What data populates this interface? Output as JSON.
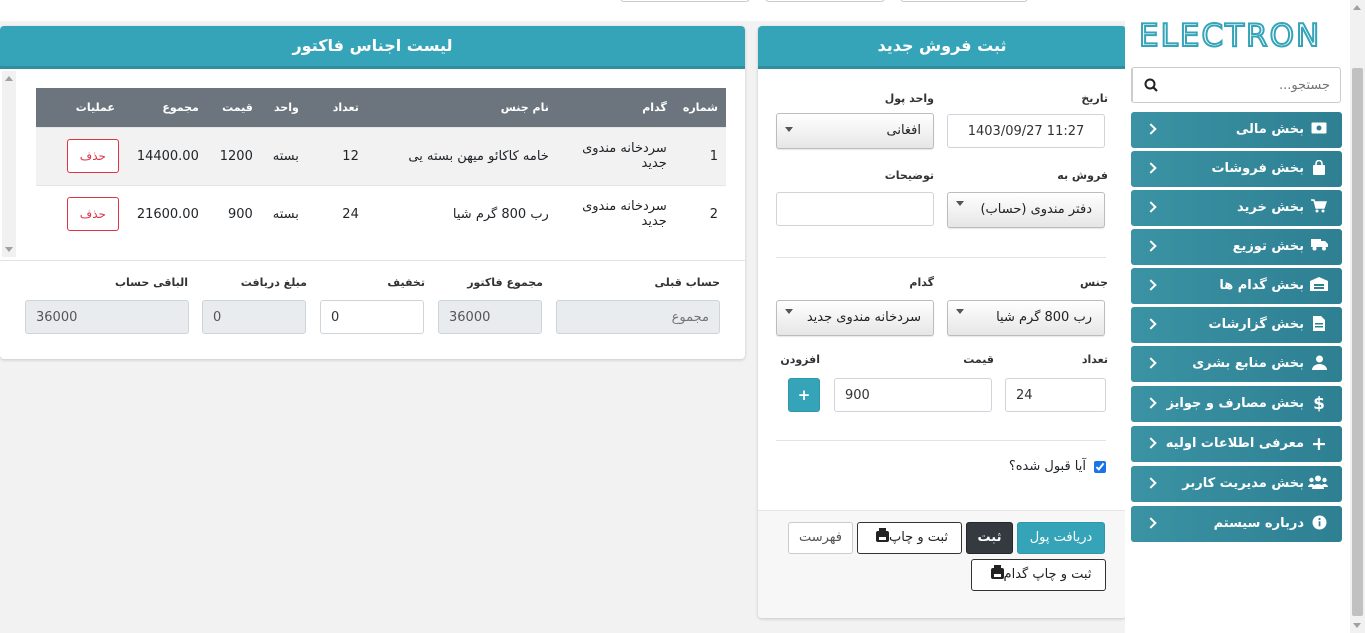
{
  "brand": {
    "logo_text": "ELECTRON",
    "accent": "#35a4b8"
  },
  "sidebar": {
    "search_placeholder": "جستجو...",
    "items": [
      {
        "label": "بخش مالی",
        "icon": "money-icon"
      },
      {
        "label": "بخش فروشات",
        "icon": "shopping-bag-icon"
      },
      {
        "label": "بخش خرید",
        "icon": "cart-icon"
      },
      {
        "label": "بخش توزیع",
        "icon": "truck-icon"
      },
      {
        "label": "بخش گدام ها",
        "icon": "warehouse-icon"
      },
      {
        "label": "بخش گزارشات",
        "icon": "file-icon"
      },
      {
        "label": "بخش منابع بشری",
        "icon": "user-icon"
      },
      {
        "label": "بخش مصارف و جوایز",
        "icon": "dollar-icon"
      },
      {
        "label": "معرفی اطلاعات اولیه",
        "icon": "plus-icon"
      },
      {
        "label": "بخش مدیریت کاربر",
        "icon": "users-icon"
      },
      {
        "label": "درباره سیستم",
        "icon": "info-icon"
      }
    ]
  },
  "sale_form": {
    "title": "ثبت فروش جدید",
    "date_label": "تاریخ",
    "date_value": "1403/09/27 11:27",
    "currency_label": "واحد پول",
    "currency_value": "افغانی",
    "sell_to_label": "فروش به",
    "sell_to_value": "دفتر مندوی (حساب)",
    "notes_label": "توضیحات",
    "notes_value": "",
    "item_label": "جنس",
    "item_value": "رب 800 گرم شیا",
    "warehouse_label": "گدام",
    "warehouse_value": "سردخانه مندوی جدید",
    "qty_label": "تعداد",
    "qty_value": "24",
    "price_label": "قیمت",
    "price_value": "900",
    "add_label": "افزودن",
    "add_button": "+",
    "accepted_label": "آیا قبول شده؟",
    "accepted": true,
    "buttons": {
      "receive": "دریافت پول",
      "save": "ثبت",
      "save_print": "ثبت و چاپ",
      "list": "فهرست",
      "save_print_warehouse": "ثبت و چاپ گدام"
    }
  },
  "invoice": {
    "title": "لیست اجناس فاکتور",
    "headers": {
      "number": "شماره",
      "warehouse": "گدام",
      "item": "نام جنس",
      "qty": "تعداد",
      "unit": "واحد",
      "price": "قیمت",
      "total": "مجموع",
      "ops": "عملیات"
    },
    "rows": [
      {
        "number": "1",
        "warehouse": "سردخانه مندوی جدید",
        "item": "خامه کاکائو میهن بسته یی",
        "qty": "12",
        "unit": "بسته",
        "price": "1200",
        "total": "14400.00",
        "delete": "حذف"
      },
      {
        "number": "2",
        "warehouse": "سردخانه مندوی جدید",
        "item": "رب 800 گرم شیا",
        "qty": "24",
        "unit": "بسته",
        "price": "900",
        "total": "21600.00",
        "delete": "حذف"
      }
    ],
    "summary": {
      "prev_account_label": "حساب قبلی",
      "prev_account_placeholder": "مجموع",
      "invoice_total_label": "مجموع فاکتور",
      "invoice_total_value": "36000",
      "discount_label": "تخفیف",
      "discount_value": "0",
      "received_label": "مبلغ دریافت",
      "received_value": "0",
      "remaining_label": "الباقی حساب",
      "remaining_value": "36000"
    }
  }
}
